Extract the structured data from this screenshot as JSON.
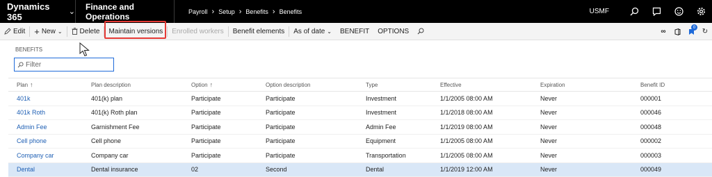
{
  "topbar": {
    "product": "Dynamics 365",
    "module": "Finance and Operations",
    "breadcrumb": [
      "Payroll",
      "Setup",
      "Benefits",
      "Benefits"
    ],
    "company": "USMF",
    "icons": [
      "search-icon",
      "message-icon",
      "smiley-icon",
      "gear-icon"
    ]
  },
  "actions": {
    "edit": "Edit",
    "new": "New",
    "delete": "Delete",
    "maintain_versions": "Maintain versions",
    "enrolled_workers": "Enrolled workers",
    "benefit_elements": "Benefit elements",
    "as_of_date": "As of date",
    "benefit": "BENEFIT",
    "options": "OPTIONS",
    "badge_count": "0"
  },
  "page": {
    "section_label": "BENEFITS",
    "filter_placeholder": "Filter"
  },
  "grid": {
    "columns": [
      "Plan",
      "Plan description",
      "Option",
      "Option description",
      "Type",
      "Effective",
      "Expiration",
      "Benefit ID"
    ],
    "rows": [
      [
        "401k",
        "401(k) plan",
        "Participate",
        "Participate",
        "Investment",
        "1/1/2005 08:00 AM",
        "Never",
        "000001"
      ],
      [
        "401k Roth",
        "401(k) Roth plan",
        "Participate",
        "Participate",
        "Investment",
        "1/1/2018 08:00 AM",
        "Never",
        "000046"
      ],
      [
        "Admin Fee",
        "Garnishment Fee",
        "Participate",
        "Participate",
        "Admin Fee",
        "1/1/2019 08:00 AM",
        "Never",
        "000048"
      ],
      [
        "Cell phone",
        "Cell phone",
        "Participate",
        "Participate",
        "Equipment",
        "1/1/2005 08:00 AM",
        "Never",
        "000002"
      ],
      [
        "Company car",
        "Company car",
        "Participate",
        "Participate",
        "Transportation",
        "1/1/2005 08:00 AM",
        "Never",
        "000003"
      ],
      [
        "Dental",
        "Dental insurance",
        "02",
        "Second",
        "Dental",
        "1/1/2019 12:00 AM",
        "Never",
        "000049"
      ]
    ]
  },
  "colors": {
    "topbar": "#000000",
    "link": "#1e5fb4",
    "selected_row": "#d9e7f7",
    "highlight_box": "#e53935"
  }
}
